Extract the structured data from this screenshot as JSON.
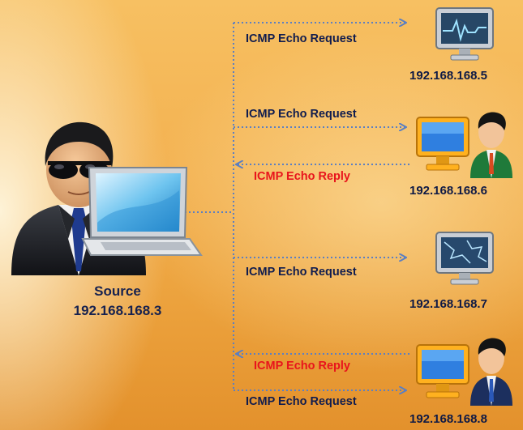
{
  "source": {
    "label": "Source",
    "ip": "192.168.168.3",
    "icon": "hacker-with-laptop-icon"
  },
  "targets": [
    {
      "ip": "192.168.168.5",
      "icon": "monitor-heartbeat-icon",
      "messages": [
        {
          "type": "request",
          "label": "ICMP Echo Request"
        }
      ]
    },
    {
      "ip": "192.168.168.6",
      "icon": "user-with-monitor-icon",
      "messages": [
        {
          "type": "request",
          "label": "ICMP Echo Request"
        },
        {
          "type": "reply",
          "label": "ICMP Echo Reply"
        }
      ]
    },
    {
      "ip": "192.168.168.7",
      "icon": "monitor-cracked-icon",
      "messages": [
        {
          "type": "request",
          "label": "ICMP Echo Request"
        }
      ]
    },
    {
      "ip": "192.168.168.8",
      "icon": "user-with-monitor-icon",
      "messages": [
        {
          "type": "reply",
          "label": "ICMP Echo Reply"
        },
        {
          "type": "request",
          "label": "ICMP Echo Request"
        }
      ]
    }
  ],
  "colors": {
    "request_text": "#101c4e",
    "reply_text": "#e8141c",
    "connector": "#5b7fc2",
    "background": "#f3b150"
  }
}
